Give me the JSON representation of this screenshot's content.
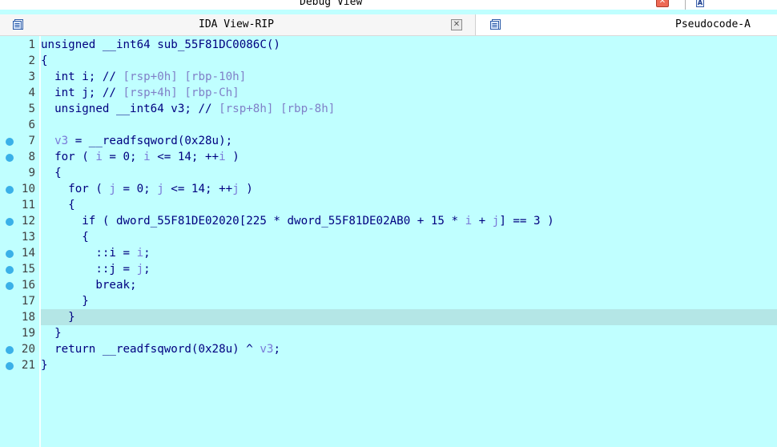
{
  "debug_view": {
    "title": "Debug View",
    "close_glyph": "✕"
  },
  "tabs": {
    "ida": {
      "label": "IDA View-RIP",
      "icon": "document-icon",
      "close_glyph": "✕"
    },
    "pseudo": {
      "label": "Pseudocode-A",
      "icon": "document-icon"
    },
    "hex_icon_glyph": "A"
  },
  "lines": [
    {
      "n": "1",
      "bp": false,
      "hl": false,
      "indent": "",
      "tokens": [
        [
          "k",
          "unsigned __int64 sub_55F81DC0086C()"
        ]
      ]
    },
    {
      "n": "2",
      "bp": false,
      "hl": false,
      "indent": "",
      "tokens": [
        [
          "k",
          "{"
        ]
      ]
    },
    {
      "n": "3",
      "bp": false,
      "hl": false,
      "indent": "  ",
      "tokens": [
        [
          "k",
          "int i; // "
        ],
        [
          "c",
          "[rsp+0h] [rbp-10h]"
        ]
      ]
    },
    {
      "n": "4",
      "bp": false,
      "hl": false,
      "indent": "  ",
      "tokens": [
        [
          "k",
          "int j; // "
        ],
        [
          "c",
          "[rsp+4h] [rbp-Ch]"
        ]
      ]
    },
    {
      "n": "5",
      "bp": false,
      "hl": false,
      "indent": "  ",
      "tokens": [
        [
          "k",
          "unsigned __int64 v3; // "
        ],
        [
          "c",
          "[rsp+8h] [rbp-8h]"
        ]
      ]
    },
    {
      "n": "6",
      "bp": false,
      "hl": false,
      "indent": "",
      "tokens": []
    },
    {
      "n": "7",
      "bp": true,
      "hl": false,
      "indent": "  ",
      "tokens": [
        [
          "v",
          "v3"
        ],
        [
          "k",
          " = __readfsqword(0x28u);"
        ]
      ]
    },
    {
      "n": "8",
      "bp": true,
      "hl": false,
      "indent": "  ",
      "tokens": [
        [
          "k",
          "for ( "
        ],
        [
          "v",
          "i"
        ],
        [
          "k",
          " = 0; "
        ],
        [
          "v",
          "i"
        ],
        [
          "k",
          " <= 14; ++"
        ],
        [
          "v",
          "i"
        ],
        [
          "k",
          " )"
        ]
      ]
    },
    {
      "n": "9",
      "bp": false,
      "hl": false,
      "indent": "  ",
      "tokens": [
        [
          "k",
          "{"
        ]
      ]
    },
    {
      "n": "10",
      "bp": true,
      "hl": false,
      "indent": "    ",
      "tokens": [
        [
          "k",
          "for ( "
        ],
        [
          "v",
          "j"
        ],
        [
          "k",
          " = 0; "
        ],
        [
          "v",
          "j"
        ],
        [
          "k",
          " <= 14; ++"
        ],
        [
          "v",
          "j"
        ],
        [
          "k",
          " )"
        ]
      ]
    },
    {
      "n": "11",
      "bp": false,
      "hl": false,
      "indent": "    ",
      "tokens": [
        [
          "k",
          "{"
        ]
      ]
    },
    {
      "n": "12",
      "bp": true,
      "hl": false,
      "indent": "      ",
      "tokens": [
        [
          "k",
          "if ( dword_55F81DE02020[225 * dword_55F81DE02AB0 + 15 * "
        ],
        [
          "v",
          "i"
        ],
        [
          "k",
          " + "
        ],
        [
          "v",
          "j"
        ],
        [
          "k",
          "] == 3 )"
        ]
      ]
    },
    {
      "n": "13",
      "bp": false,
      "hl": false,
      "indent": "      ",
      "tokens": [
        [
          "k",
          "{"
        ]
      ]
    },
    {
      "n": "14",
      "bp": true,
      "hl": false,
      "indent": "        ",
      "tokens": [
        [
          "k",
          "::i = "
        ],
        [
          "v",
          "i"
        ],
        [
          "k",
          ";"
        ]
      ]
    },
    {
      "n": "15",
      "bp": true,
      "hl": false,
      "indent": "        ",
      "tokens": [
        [
          "k",
          "::j = "
        ],
        [
          "v",
          "j"
        ],
        [
          "k",
          ";"
        ]
      ]
    },
    {
      "n": "16",
      "bp": true,
      "hl": false,
      "indent": "        ",
      "tokens": [
        [
          "k",
          "break;"
        ]
      ]
    },
    {
      "n": "17",
      "bp": false,
      "hl": false,
      "indent": "      ",
      "tokens": [
        [
          "k",
          "}"
        ]
      ]
    },
    {
      "n": "18",
      "bp": false,
      "hl": true,
      "indent": "    ",
      "tokens": [
        [
          "k",
          "}"
        ]
      ]
    },
    {
      "n": "19",
      "bp": false,
      "hl": false,
      "indent": "  ",
      "tokens": [
        [
          "k",
          "}"
        ]
      ]
    },
    {
      "n": "20",
      "bp": true,
      "hl": false,
      "indent": "  ",
      "tokens": [
        [
          "k",
          "return __readfsqword(0x28u) ^ "
        ],
        [
          "v",
          "v3"
        ],
        [
          "k",
          ";"
        ]
      ]
    },
    {
      "n": "21",
      "bp": true,
      "hl": false,
      "indent": "",
      "tokens": [
        [
          "k",
          "}"
        ]
      ]
    }
  ],
  "colors": {
    "background": "#c0ffff",
    "keyword": "#000080",
    "comment": "#8080c8",
    "variable": "#7a7ad8",
    "breakpoint": "#3ab0e8",
    "highlight": "#b4e6e6"
  }
}
